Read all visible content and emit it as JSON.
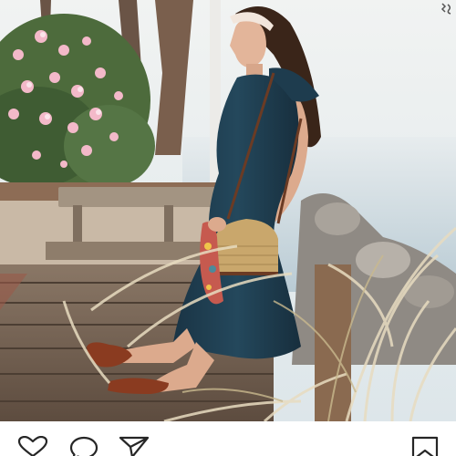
{
  "post": {
    "photo_description_icon": "photo",
    "accent": "#1b3a4b",
    "actions": {
      "like_icon": "heart-outline-icon",
      "comment_icon": "speech-bubble-icon",
      "share_icon": "paper-plane-icon",
      "save_icon": "bookmark-icon"
    }
  }
}
